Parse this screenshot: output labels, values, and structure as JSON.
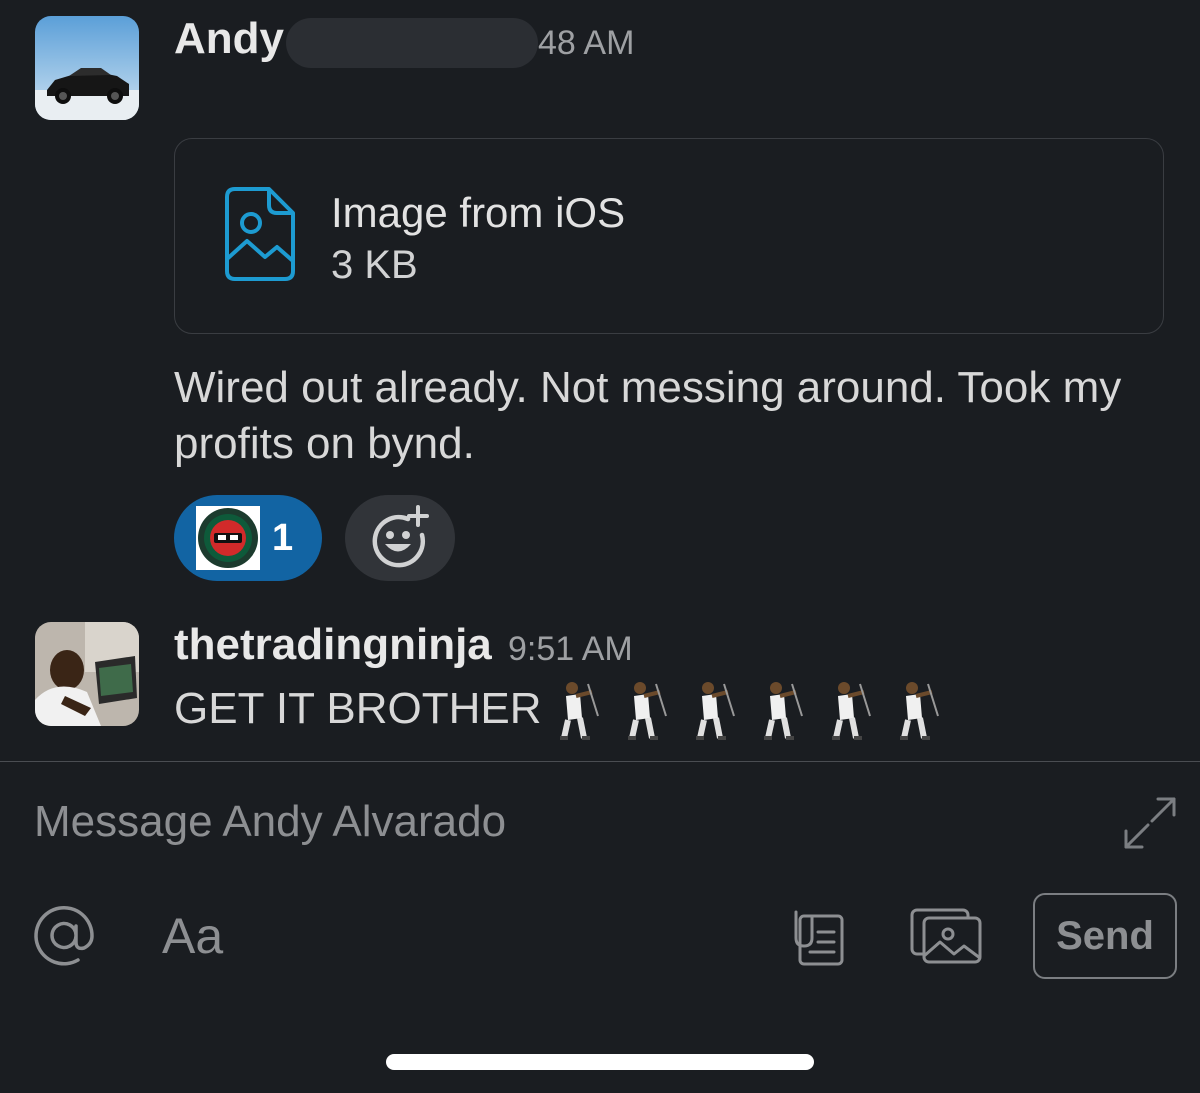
{
  "messages": [
    {
      "sender": "Andy",
      "time": "48 AM",
      "avatar": "car-photo",
      "attachment": {
        "icon": "image-file-icon",
        "name": "Image from iOS",
        "size": "3 KB"
      },
      "text": "Wired out already. Not messing around. Took my profits on bynd.",
      "reactions": [
        {
          "emoji": "ninja-custom-emoji",
          "count": "1"
        }
      ],
      "add_reaction_icon": "add-reaction-icon"
    },
    {
      "sender": "thetradingninja",
      "time": "9:51 AM",
      "avatar": "person-laptop-photo",
      "text": "GET IT BROTHER",
      "emoji": [
        "golfer",
        "golfer",
        "golfer",
        "golfer",
        "golfer",
        "golfer"
      ]
    }
  ],
  "composer": {
    "placeholder": "Message Andy Alvarado",
    "format_label": "Aa",
    "send_label": "Send",
    "icons": [
      "at-sign-icon",
      "format-icon",
      "attach-file-icon",
      "photo-library-icon",
      "expand-icon"
    ]
  },
  "colors": {
    "background": "#1a1d21",
    "reaction_bg": "#1264a3",
    "file_icon": "#1d9bd1",
    "muted_text": "#8d8f92"
  }
}
